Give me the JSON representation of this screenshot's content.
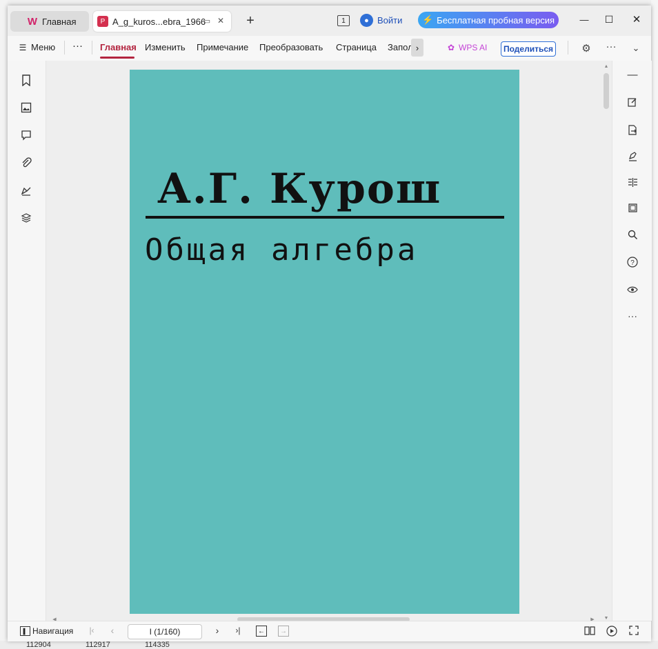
{
  "tabs": {
    "home_label": "Главная",
    "doc_label": "A_g_kuros...ebra_1966",
    "close": "✕",
    "new_tab": "+"
  },
  "titlebar": {
    "page_count_badge": "1",
    "login_label": "Войти",
    "trial_label": "Бесплатная пробная версия",
    "minimize": "—",
    "maximize": "☐",
    "close": "✕"
  },
  "toolbar": {
    "menu_label": "Меню",
    "more": "···",
    "items": [
      "Главная",
      "Изменить",
      "Примечание",
      "Преобразовать",
      "Страница",
      "Запол"
    ],
    "active_index": 0,
    "wps_ai_label": "WPS AI",
    "share_label": "Поделиться"
  },
  "document": {
    "author": "А.Г. Курош",
    "title": "Общая алгебра",
    "cover_color": "#5fbdbb"
  },
  "statusbar": {
    "nav_label": "Навигация",
    "page_input": "I (1/160)"
  },
  "background": {
    "bottom_numbers": [
      "112904",
      "112917",
      "114335"
    ]
  },
  "colors": {
    "accent": "#b3243f",
    "link_blue": "#2f6fd6"
  },
  "icons": {
    "left_rail": [
      "bookmark-icon",
      "image-icon",
      "comment-icon",
      "attachment-icon",
      "signature-icon",
      "layers-icon"
    ],
    "right_rail": [
      "collapse-icon",
      "edit-icon",
      "export-icon",
      "sign-pen-icon",
      "compare-icon",
      "crop-icon",
      "search-icon",
      "help-icon",
      "eye-icon",
      "more-icon"
    ]
  }
}
